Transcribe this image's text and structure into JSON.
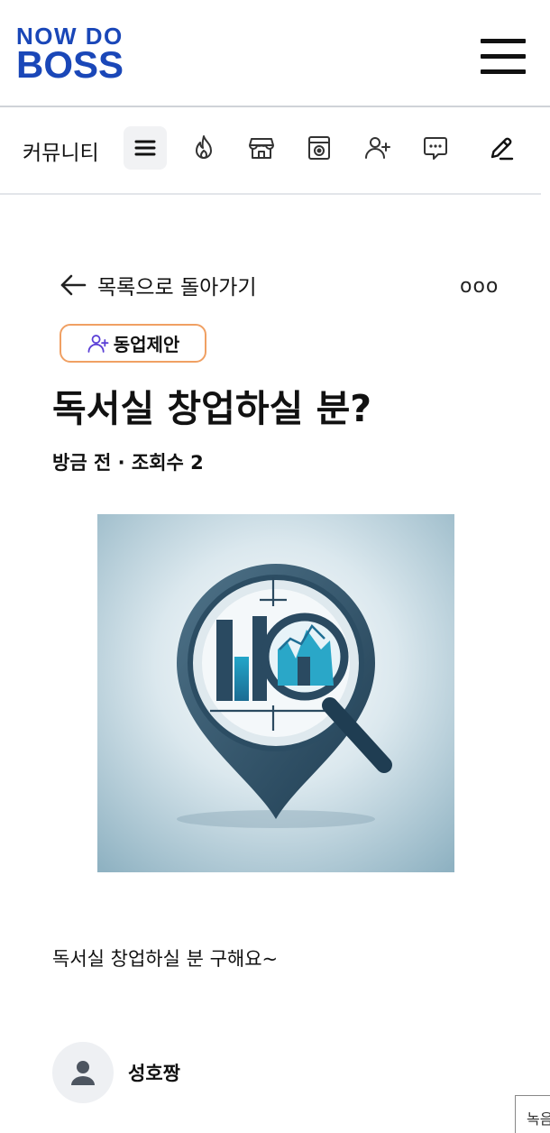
{
  "header": {
    "logo_line1": "NOW DO",
    "logo_line2": "BOSS",
    "brand_color": "#1a47b8",
    "menu_icon": "hamburger-menu-icon"
  },
  "category_bar": {
    "title": "커뮤니티",
    "icons": [
      "list-icon",
      "fire-icon",
      "store-icon",
      "shop-window-icon",
      "user-plus-icon",
      "chat-bubble-icon",
      "pencil-icon"
    ]
  },
  "post": {
    "back_label": "목록으로 돌아가기",
    "more_label": "ooo",
    "tag_label": "동업제안",
    "tag_border_color": "#f0a063",
    "title": "독서실 창업하실 분?",
    "meta": "방금 전 · 조회수 2",
    "image_icon": "location-magnifier-illustration",
    "body": "독서실 창업하실 분 구해요~"
  },
  "author": {
    "name": "성호짱",
    "avatar_icon": "user-avatar-icon"
  },
  "corner_widget": {
    "label": "녹음"
  }
}
